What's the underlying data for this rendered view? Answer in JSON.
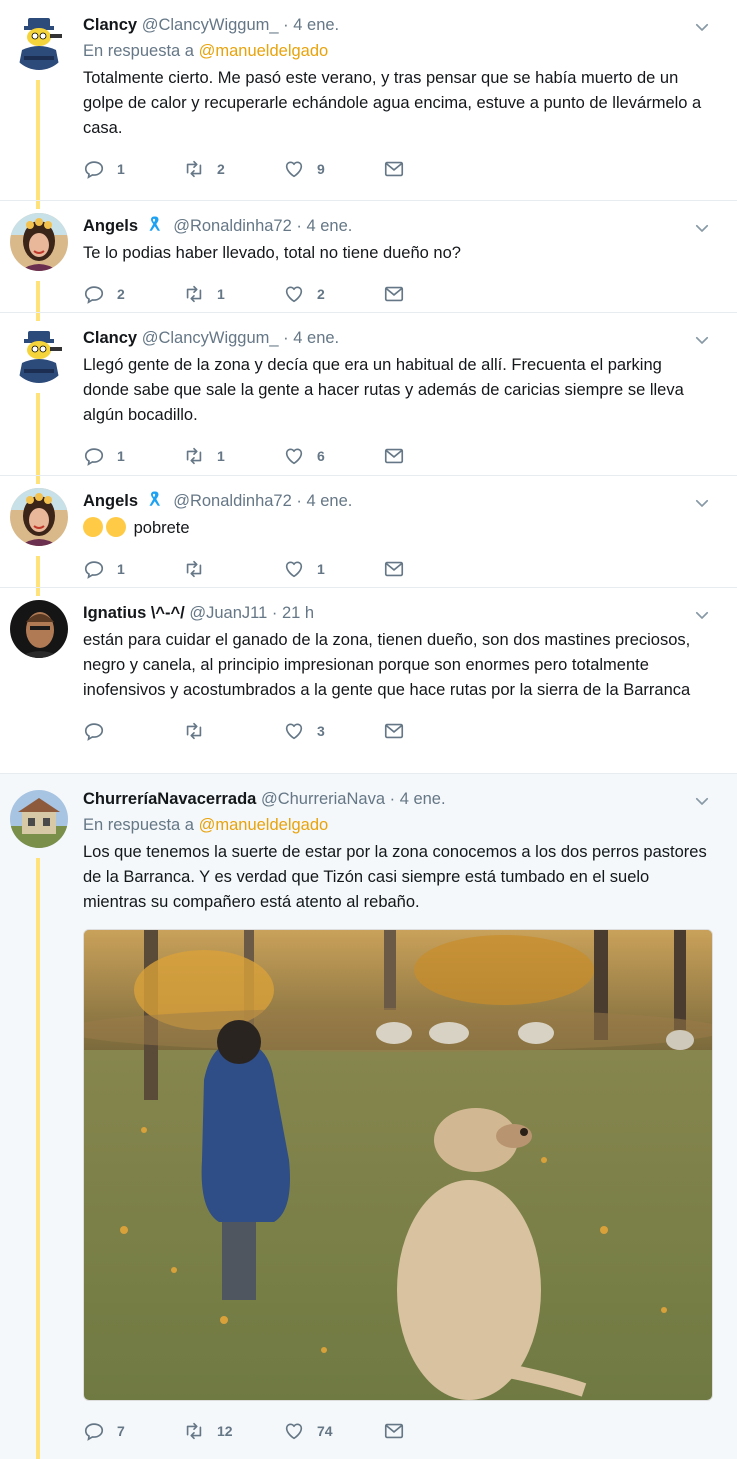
{
  "tweets": [
    {
      "name": "Clancy",
      "handle": "@ClancyWiggum_",
      "time": "4 ene.",
      "reply_prefix": "En respuesta a",
      "reply_to": "@manueldelgado",
      "text": "Totalmente cierto.  Me pasó este verano, y tras pensar que se había muerto de un golpe de calor y recuperarle echándole agua encima, estuve a punto de llevármelo a casa.",
      "replies": "1",
      "retweets": "2",
      "likes": "9"
    },
    {
      "name": "Angels",
      "handle": "@Ronaldinha72",
      "time": "4 ene.",
      "text": "Te lo podias haber llevado, total no tiene dueño no?",
      "replies": "2",
      "retweets": "1",
      "likes": "2"
    },
    {
      "name": "Clancy",
      "handle": "@ClancyWiggum_",
      "time": "4 ene.",
      "text": "Llegó gente de la zona y decía que era un habitual de allí.  Frecuenta el parking donde sabe que sale la gente a hacer rutas y además de caricias siempre se lleva algún bocadillo.",
      "replies": "1",
      "retweets": "1",
      "likes": "6"
    },
    {
      "name": "Angels",
      "handle": "@Ronaldinha72",
      "time": "4 ene.",
      "text": "pobrete",
      "replies": "1",
      "retweets": "",
      "likes": "1"
    },
    {
      "name": "Ignatius \\^-^/",
      "handle": "@JuanJ11",
      "time": "21 h",
      "text": "están para cuidar el ganado de la zona, tienen dueño, son dos mastines preciosos, negro y canela, al principio impresionan porque son enormes pero totalmente inofensivos y acostumbrados a la gente que hace rutas por la sierra de la Barranca",
      "replies": "",
      "retweets": "",
      "likes": "3"
    },
    {
      "name": "ChurreríaNavacerrada",
      "handle": "@ChurreriaNava",
      "time": "4 ene.",
      "reply_prefix": "En respuesta a",
      "reply_to": "@manueldelgado",
      "text": "Los que tenemos la suerte de estar por la zona conocemos a los dos perros pastores de la Barranca. Y es verdad que Tizón casi siempre está tumbado en el suelo mientras su compañero está atento al rebaño.",
      "replies": "7",
      "retweets": "12",
      "likes": "74"
    }
  ],
  "separator": "·",
  "colors": {
    "thread": "#ffe27a",
    "accent": "#e8a30c",
    "muted": "#657786",
    "highlight": "#f5f8fa"
  }
}
